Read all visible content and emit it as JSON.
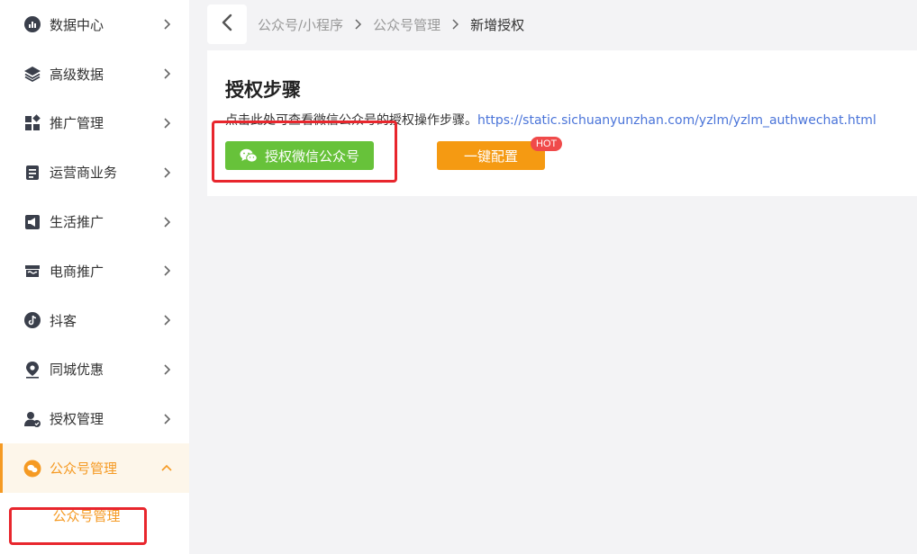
{
  "sidebar": {
    "items": [
      {
        "label": "数据中心",
        "icon": "chart-circle-icon"
      },
      {
        "label": "高级数据",
        "icon": "layers-icon"
      },
      {
        "label": "推广管理",
        "icon": "grid-icon"
      },
      {
        "label": "运营商业务",
        "icon": "document-icon"
      },
      {
        "label": "生活推广",
        "icon": "megaphone-icon"
      },
      {
        "label": "电商推广",
        "icon": "store-icon"
      },
      {
        "label": "抖客",
        "icon": "tiktok-icon"
      },
      {
        "label": "同城优惠",
        "icon": "location-pin-icon"
      },
      {
        "label": "授权管理",
        "icon": "user-check-icon"
      },
      {
        "label": "公众号管理",
        "icon": "wechat-icon"
      }
    ],
    "submenu": {
      "label": "公众号管理"
    }
  },
  "breadcrumb": {
    "items": [
      "公众号/小程序",
      "公众号管理",
      "新增授权"
    ]
  },
  "panel": {
    "title": "授权步骤",
    "desc_prefix": "点击此处可查看微信公众号的授权操作步骤。",
    "link": "https://static.sichuanyunzhan.com/yzlm/yzlm_authwechat.html",
    "wechat_button": "授权微信公众号",
    "config_button": "一键配置",
    "hot_badge": "HOT"
  },
  "colors": {
    "accent": "#f59a23",
    "green": "#67c23a",
    "orange": "#f59a12",
    "highlight": "#e8262d",
    "link": "#4a74d9"
  }
}
